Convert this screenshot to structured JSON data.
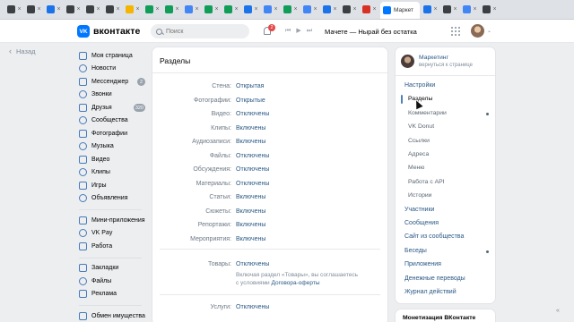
{
  "browser": {
    "tabs": [
      {
        "color": "#3c4043"
      },
      {
        "color": "#3c4043"
      },
      {
        "color": "#1a73e8"
      },
      {
        "color": "#3c4043"
      },
      {
        "color": "#3c4043"
      },
      {
        "color": "#3c4043"
      },
      {
        "color": "#f4b400"
      },
      {
        "color": "#0f9d58"
      },
      {
        "color": "#0f9d58"
      },
      {
        "color": "#4285f4"
      },
      {
        "color": "#0f9d58"
      },
      {
        "color": "#0f9d58"
      },
      {
        "color": "#1a73e8"
      },
      {
        "color": "#4285f4"
      },
      {
        "color": "#0f9d58"
      },
      {
        "color": "#4285f4"
      },
      {
        "color": "#1a73e8"
      },
      {
        "color": "#3c4043"
      },
      {
        "color": "#d93025"
      }
    ],
    "active_tab_label": "Маркет",
    "extra_tabs": [
      {
        "color": "#1a73e8"
      },
      {
        "color": "#3c4043"
      },
      {
        "color": "#4285f4"
      },
      {
        "color": "#3c4043"
      }
    ]
  },
  "header": {
    "logo_glyph": "VK",
    "logo_text": "вконтакте",
    "search_placeholder": "Поиск",
    "notifications_count": "2",
    "now_playing": "Мачете — Нырай без остатка"
  },
  "back_label": "Назад",
  "left_nav": {
    "group1": [
      {
        "label": "Моя страница",
        "badge": ""
      },
      {
        "label": "Новости",
        "badge": ""
      },
      {
        "label": "Мессенджер",
        "badge": "2"
      },
      {
        "label": "Звонки",
        "badge": ""
      },
      {
        "label": "Друзья",
        "badge": "320"
      },
      {
        "label": "Сообщества",
        "badge": ""
      },
      {
        "label": "Фотографии",
        "badge": ""
      },
      {
        "label": "Музыка",
        "badge": ""
      },
      {
        "label": "Видео",
        "badge": ""
      },
      {
        "label": "Клипы",
        "badge": ""
      },
      {
        "label": "Игры",
        "badge": ""
      },
      {
        "label": "Объявления",
        "badge": ""
      }
    ],
    "group2": [
      {
        "label": "Мини-приложения"
      },
      {
        "label": "VK Pay"
      },
      {
        "label": "Работа"
      }
    ],
    "group3": [
      {
        "label": "Закладки"
      },
      {
        "label": "Файлы"
      },
      {
        "label": "Реклама"
      }
    ],
    "group4": [
      {
        "label": "Обмен имущества"
      }
    ]
  },
  "sections": {
    "title": "Разделы",
    "rows": [
      {
        "label": "Стена:",
        "value": "Открытая"
      },
      {
        "label": "Фотографии:",
        "value": "Открытые"
      },
      {
        "label": "Видео:",
        "value": "Отключены"
      },
      {
        "label": "Клипы:",
        "value": "Включены"
      },
      {
        "label": "Аудиозаписи:",
        "value": "Включены"
      },
      {
        "label": "Файлы:",
        "value": "Отключены"
      },
      {
        "label": "Обсуждения:",
        "value": "Отключены"
      },
      {
        "label": "Материалы:",
        "value": "Отключены"
      },
      {
        "label": "Статьи:",
        "value": "Включены"
      },
      {
        "label": "Сюжеты:",
        "value": "Включены"
      },
      {
        "label": "Репортажи:",
        "value": "Включены"
      },
      {
        "label": "Мероприятия:",
        "value": "Включены"
      }
    ],
    "goods": {
      "label": "Товары:",
      "value": "Отключены",
      "note_line1": "Включая раздел «Товары», вы соглашаетесь",
      "note_prefix": "с условиями ",
      "note_link": "Договора-оферты"
    },
    "services": {
      "label": "Услуги:",
      "value": "Отключены"
    }
  },
  "right_panel": {
    "community_name": "Маркетинг",
    "community_sub": "вернуться к странице",
    "items": [
      {
        "label": "Настройки",
        "type": "main",
        "dot": false
      },
      {
        "label": "Разделы",
        "type": "sub-active",
        "dot": false
      },
      {
        "label": "Комментарии",
        "type": "sub",
        "dot": true
      },
      {
        "label": "VK Donut",
        "type": "sub",
        "dot": false
      },
      {
        "label": "Ссылки",
        "type": "sub",
        "dot": false
      },
      {
        "label": "Адреса",
        "type": "sub",
        "dot": false
      },
      {
        "label": "Меню",
        "type": "sub",
        "dot": false
      },
      {
        "label": "Работа с API",
        "type": "sub",
        "dot": false
      },
      {
        "label": "Истории",
        "type": "sub",
        "dot": false
      },
      {
        "label": "Участники",
        "type": "main",
        "dot": false
      },
      {
        "label": "Сообщения",
        "type": "main",
        "dot": false
      },
      {
        "label": "Сайт из сообщества",
        "type": "main",
        "dot": false
      },
      {
        "label": "Беседы",
        "type": "main",
        "dot": true
      },
      {
        "label": "Приложения",
        "type": "main",
        "dot": false
      },
      {
        "label": "Денежные переводы",
        "type": "main",
        "dot": false
      },
      {
        "label": "Журнал действий",
        "type": "main",
        "dot": false
      }
    ],
    "monetization_title": "Монетизация ВКонтакте"
  },
  "colors": {
    "accent": "#0077ff",
    "link": "#2a5885",
    "badge": "#99a2ad",
    "notify": "#e64646"
  }
}
